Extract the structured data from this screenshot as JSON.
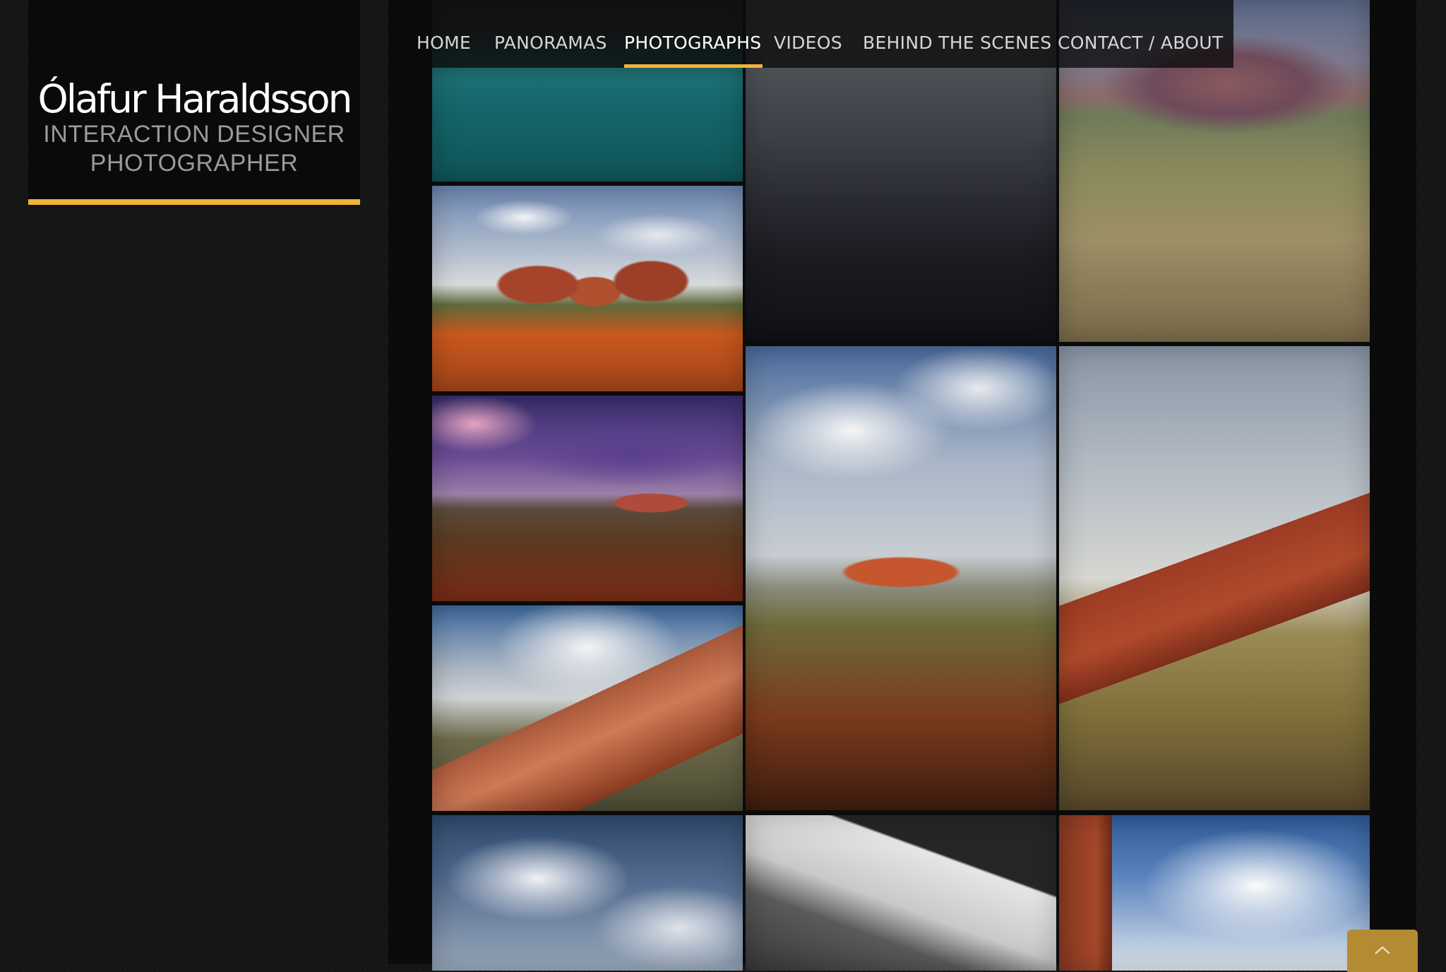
{
  "header": {
    "name": "Ólafur Haraldsson",
    "tagline_lines": [
      "INTERACTION DESIGNER",
      "PHOTOGRAPHER"
    ]
  },
  "nav": {
    "items": [
      {
        "label": "HOME",
        "active": false
      },
      {
        "label": "PANORAMAS",
        "active": false
      },
      {
        "label": "PHOTOGRAPHS",
        "active": true
      },
      {
        "label": "VIDEOS",
        "active": false
      },
      {
        "label": "BEHIND THE SCENES",
        "active": false
      },
      {
        "label": "CONTACT / ABOUT",
        "active": false
      }
    ]
  },
  "gallery": {
    "photos": [
      {
        "subject": "teal ocean"
      },
      {
        "subject": "dark misty mountains"
      },
      {
        "subject": "kata tjuta with trees"
      },
      {
        "subject": "kata tjuta red domes under clouds"
      },
      {
        "subject": "uluru at dusk under purple clouds"
      },
      {
        "subject": "uluru with rainbow and red earth"
      },
      {
        "subject": "uluru close-up with rainbow"
      },
      {
        "subject": "uluru rock face with low clouds"
      },
      {
        "subject": "clouds in blue sky"
      },
      {
        "subject": "rock texture black and white"
      },
      {
        "subject": "red rock wall with white clouds"
      }
    ]
  },
  "colors": {
    "accent": "#f0b33c",
    "background": "#141414",
    "panel": "#0a0a0a"
  },
  "back_to_top": {
    "icon": "chevron-up-icon"
  }
}
